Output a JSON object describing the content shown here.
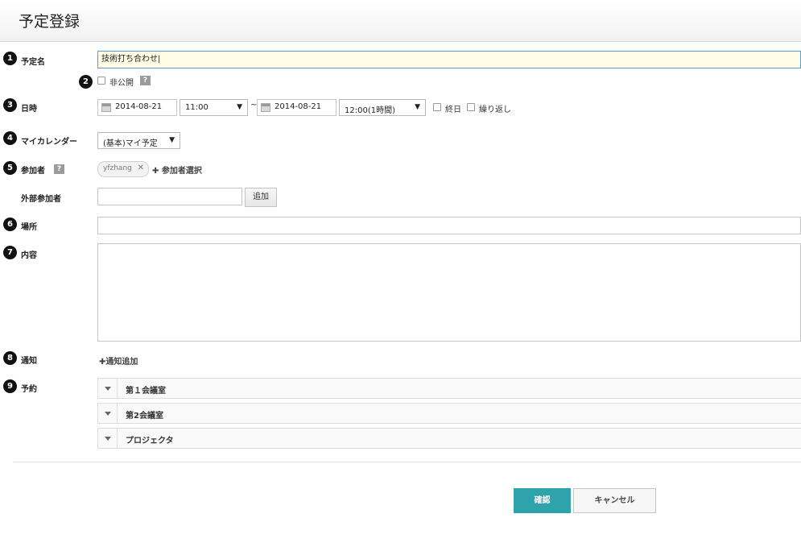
{
  "page": {
    "title": "予定登録"
  },
  "markers": [
    "1",
    "2",
    "3",
    "4",
    "5",
    "6",
    "7",
    "8",
    "9"
  ],
  "labels": {
    "title": "予定名",
    "datetime": "日時",
    "calendar": "マイカレンダー",
    "participants": "参加者",
    "external": "外部参加者",
    "place": "場所",
    "content": "内容",
    "notify": "通知",
    "reserve": "予約"
  },
  "title_field": {
    "value": "技術打ち合わせ|"
  },
  "private": {
    "label": "非公開",
    "help": "?",
    "checked": false
  },
  "date": {
    "start_date": "2014-08-21",
    "start_time": "11:00",
    "separator": "~",
    "end_date": "2014-08-21",
    "end_time": "12:00(1時間)",
    "all_day_label": "終日",
    "repeat_label": "繰り返し",
    "dropdown_arrow": "▼"
  },
  "calendar_select": {
    "value": "(基本)マイ予定"
  },
  "participants": {
    "help": "?",
    "chips": [
      {
        "name": "yfzhang",
        "remove": "✕"
      }
    ],
    "add_label": "✚ 参加者選択"
  },
  "external": {
    "value": "",
    "add_button": "追加"
  },
  "place_field": {
    "value": ""
  },
  "content_field": {
    "value": ""
  },
  "notify": {
    "add_label": "✚通知追加"
  },
  "reserve": {
    "rows": [
      {
        "name": "第１会議室"
      },
      {
        "name": "第2会議室"
      },
      {
        "name": "プロジェクタ"
      }
    ]
  },
  "actions": {
    "confirm": "確認",
    "cancel": "キャンセル"
  },
  "colors": {
    "primary": "#2fa3ac",
    "focus_bg": "#fffde6",
    "marker": "#111111"
  }
}
